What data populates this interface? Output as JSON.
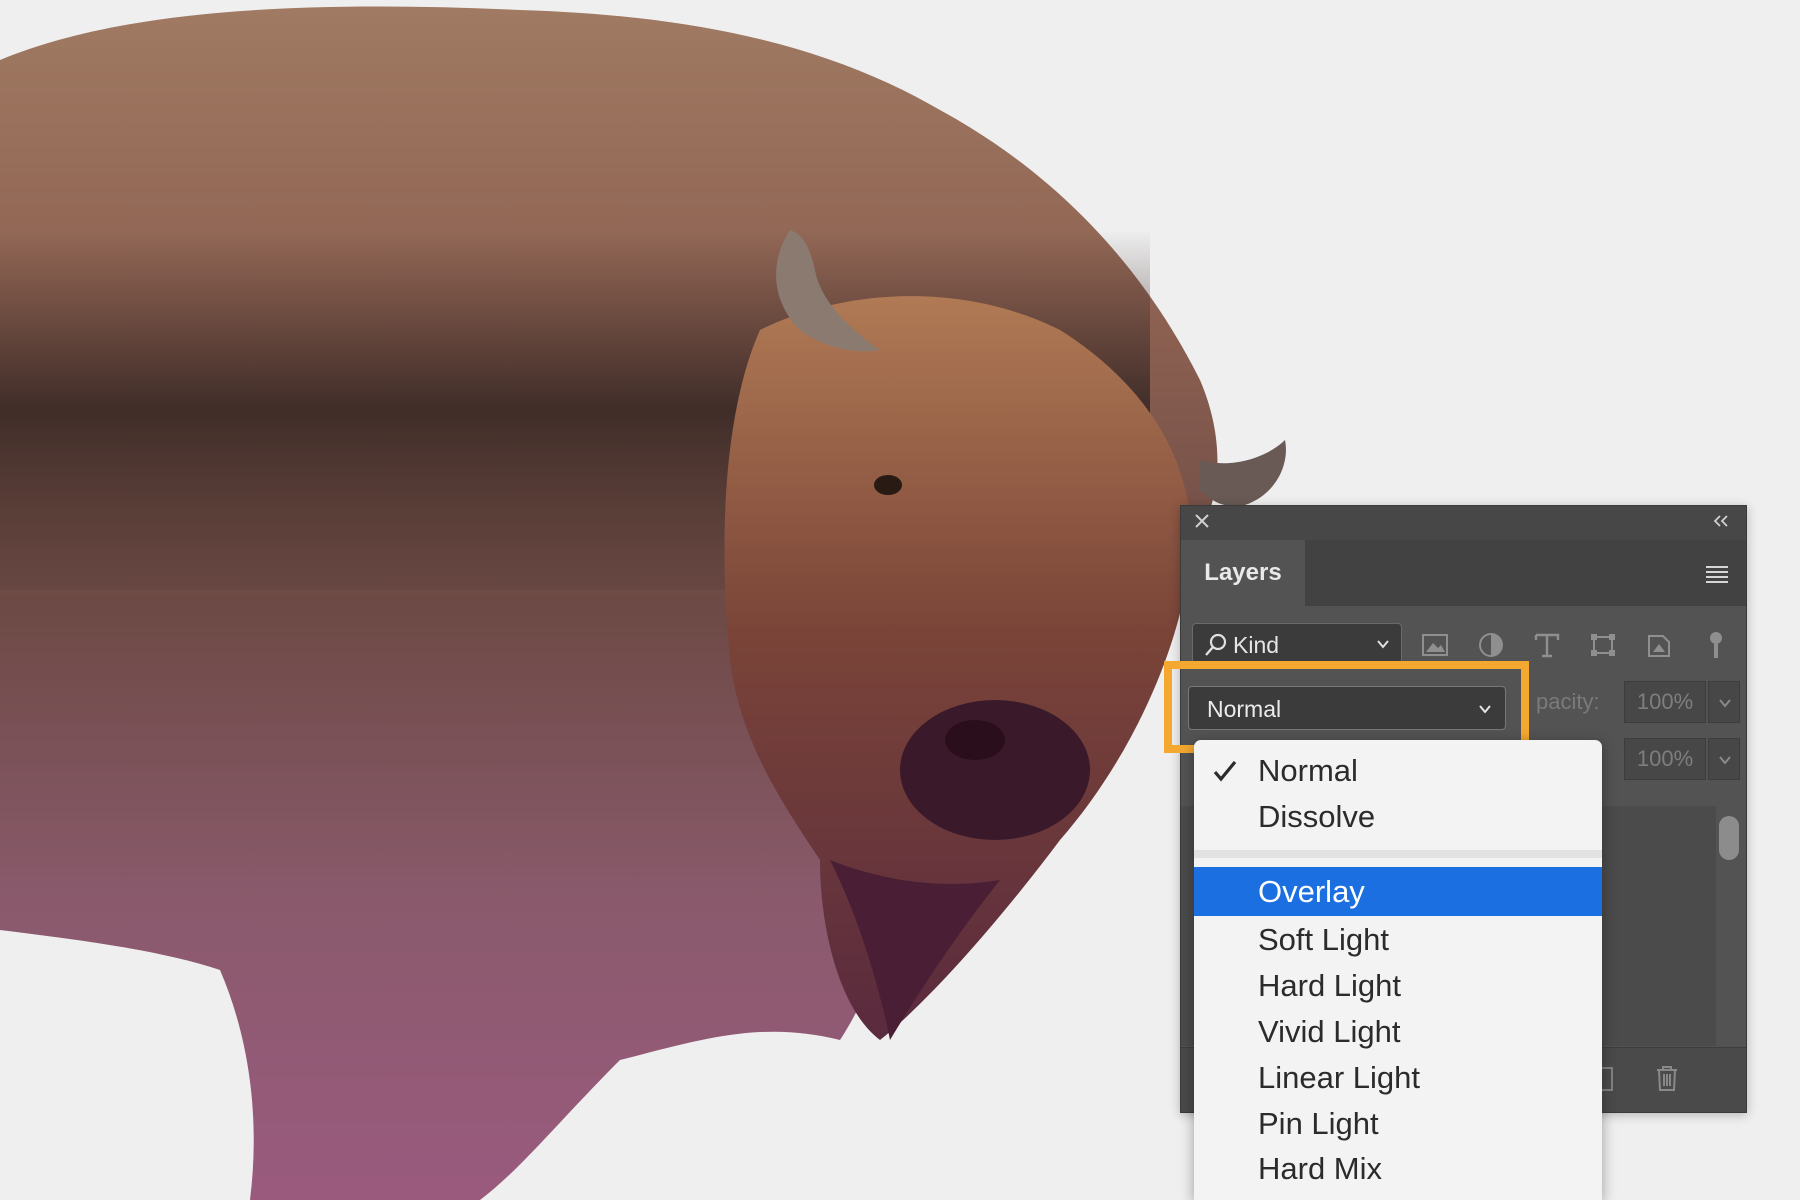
{
  "panel": {
    "tab_label": "Layers",
    "kind_filter_label": "Kind",
    "blend_mode_value": "Normal",
    "opacity_label": "pacity:",
    "opacity_value": "100%",
    "fill_label": ":",
    "fill_value": "100%"
  },
  "blend_menu": {
    "items": [
      {
        "label": "Normal",
        "checked": true
      },
      {
        "label": "Dissolve"
      },
      {
        "label": "Overlay",
        "selected": true
      },
      {
        "label": "Soft Light"
      },
      {
        "label": "Hard Light"
      },
      {
        "label": "Vivid Light"
      },
      {
        "label": "Linear Light"
      },
      {
        "label": "Pin Light"
      },
      {
        "label": "Hard Mix"
      }
    ]
  },
  "colors": {
    "highlight_frame": "#f4a82f",
    "selection": "#1b6fe0",
    "panel_bg": "#535353"
  },
  "icons": [
    "close-icon",
    "collapse-icon",
    "panel-menu-icon",
    "magnifier-icon",
    "image-filter-icon",
    "adjustment-filter-icon",
    "type-filter-icon",
    "shape-filter-icon",
    "smart-object-filter-icon",
    "checkmark-icon",
    "trash-icon",
    "new-layer-icon"
  ]
}
